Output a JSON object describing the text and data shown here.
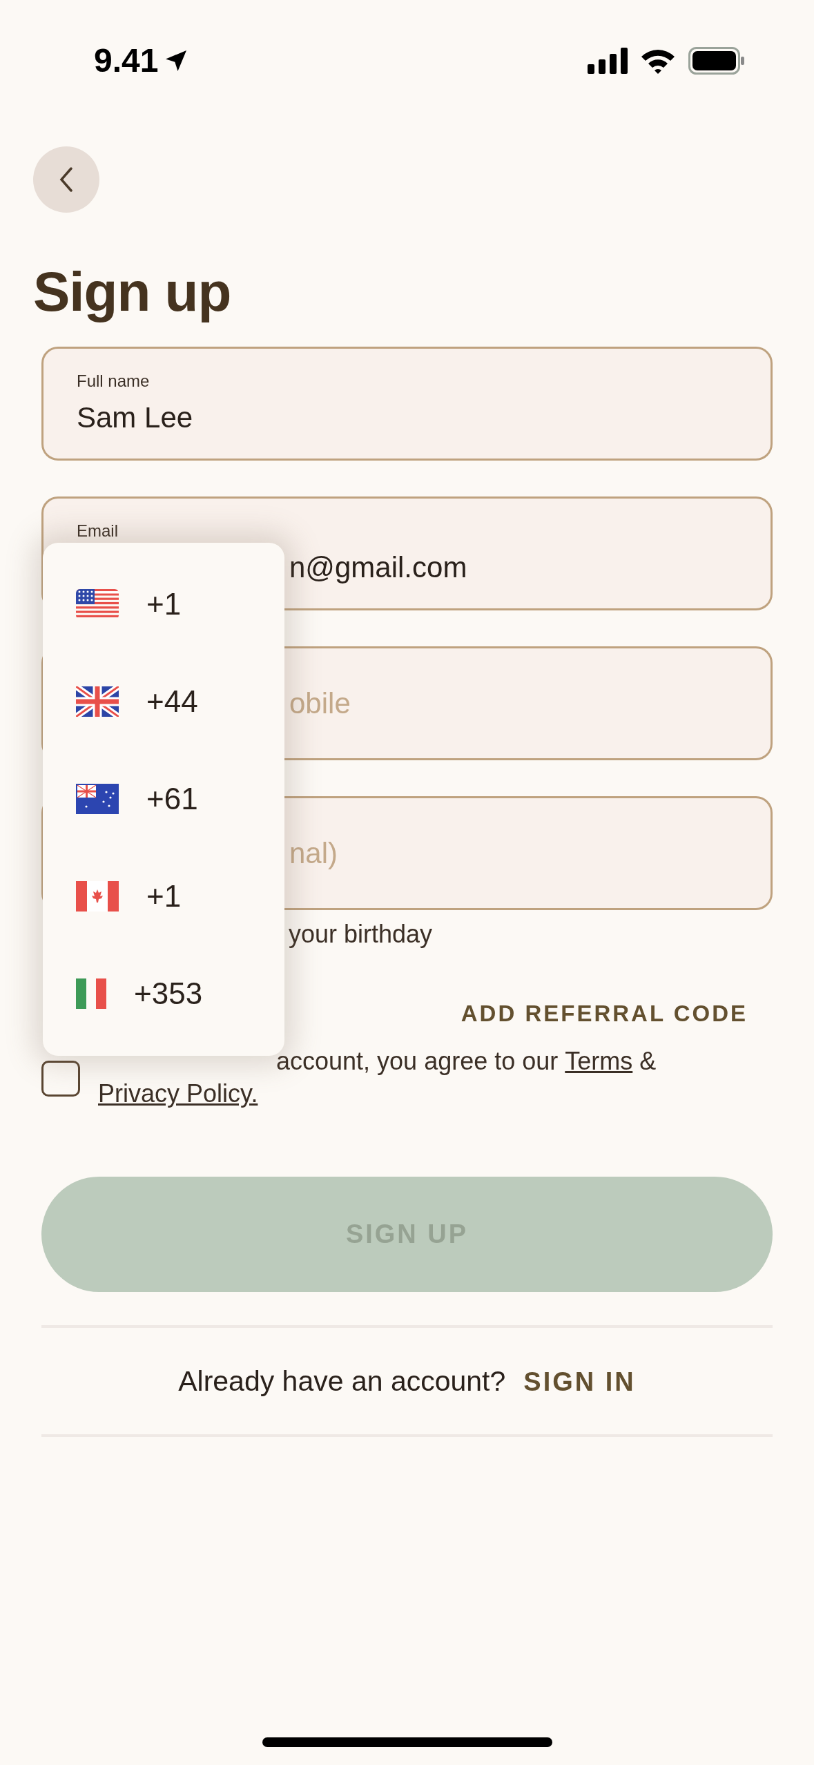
{
  "status_bar": {
    "time": "9.41"
  },
  "title": "Sign up",
  "fields": [
    {
      "label": "Full name",
      "value": "Sam Lee"
    },
    {
      "label": "Email",
      "value": "n@gmail.com"
    },
    {
      "placeholder": "obile"
    },
    {
      "placeholder": "nal)"
    }
  ],
  "helper_text": "your birthday",
  "referral_link": "ADD REFERRAL CODE",
  "terms": {
    "checked": false,
    "text": "account, you agree to our",
    "terms_link": "Terms",
    "ampersand": "&",
    "privacy_link": "Privacy Policy."
  },
  "sign_up_button": {
    "label": "SIGN UP",
    "disabled": true
  },
  "sign_in_prompt": {
    "text": "Already have an account?",
    "link": "SIGN IN"
  },
  "country_menu": [
    {
      "kind": "us",
      "code": "+1"
    },
    {
      "kind": "gb",
      "code": "+44"
    },
    {
      "kind": "au",
      "code": "+61"
    },
    {
      "kind": "ca",
      "code": "+1"
    },
    {
      "kind": "ie",
      "code": "+353"
    }
  ]
}
